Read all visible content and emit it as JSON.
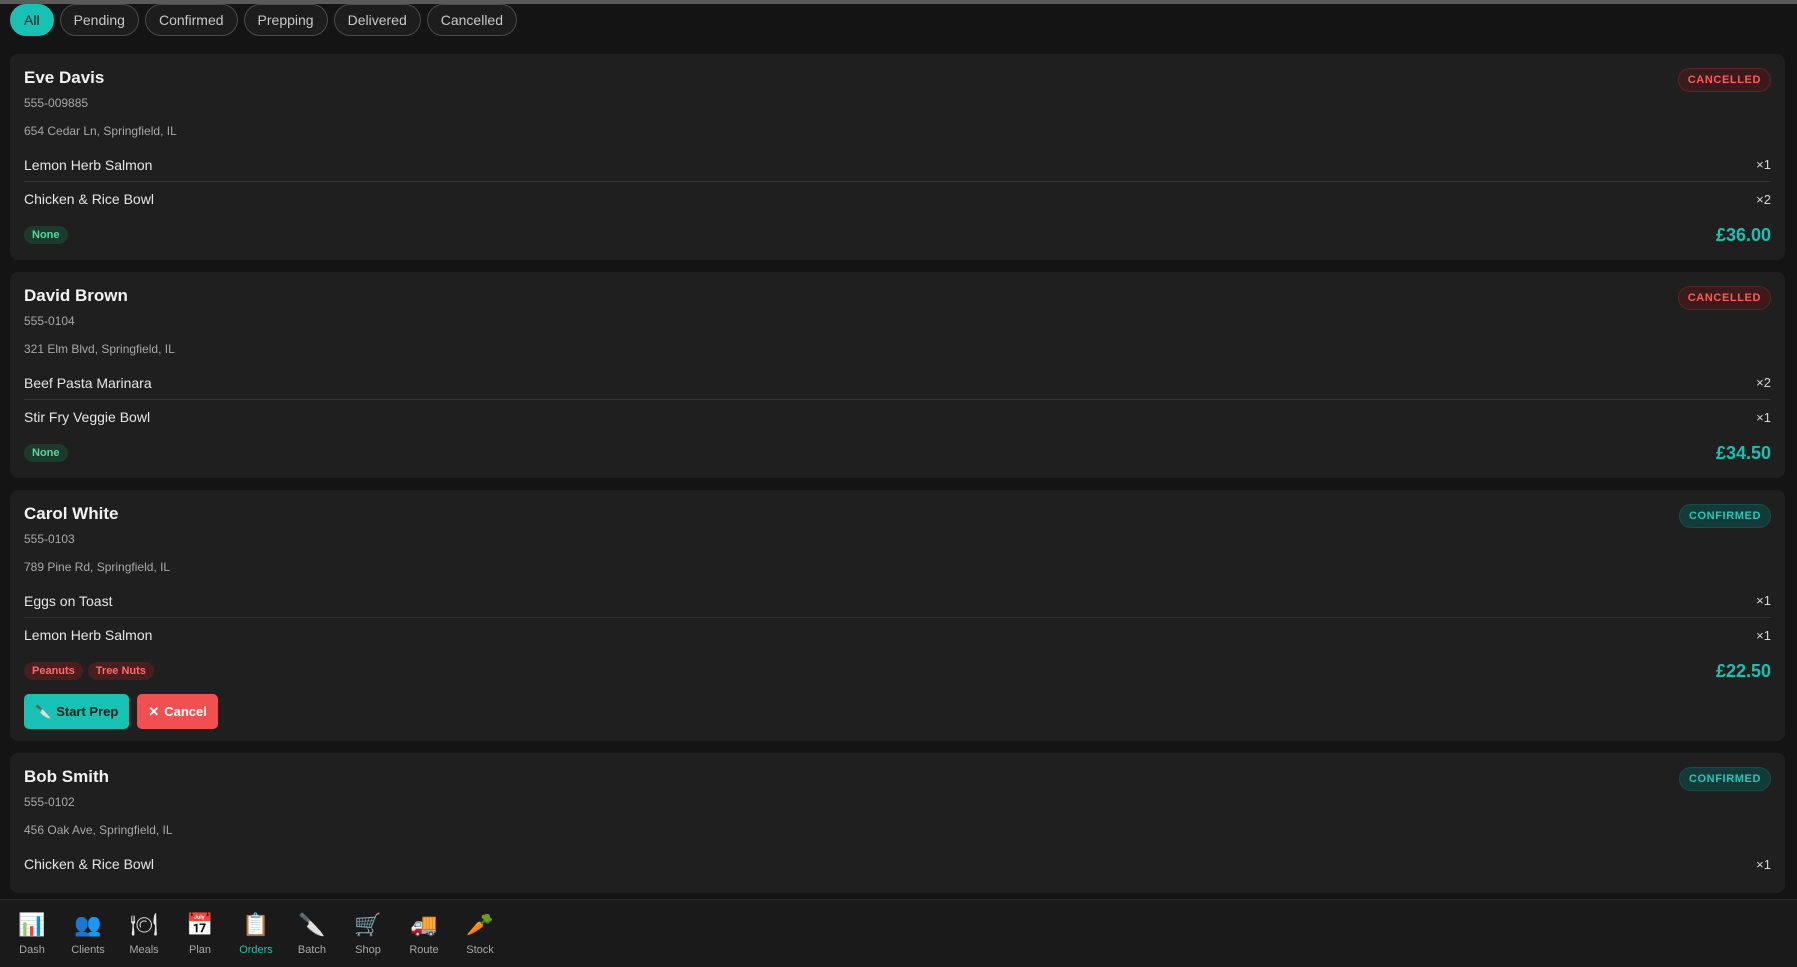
{
  "filters": [
    {
      "label": "All",
      "active": true
    },
    {
      "label": "Pending"
    },
    {
      "label": "Confirmed"
    },
    {
      "label": "Prepping"
    },
    {
      "label": "Delivered"
    },
    {
      "label": "Cancelled"
    }
  ],
  "orders": [
    {
      "name": "Eve Davis",
      "phone": "555-009885",
      "address": "654 Cedar Ln, Springfield, IL",
      "status": "CANCELLED",
      "items": [
        {
          "name": "Lemon Herb Salmon",
          "qty": "×1"
        },
        {
          "name": "Chicken & Rice Bowl",
          "qty": "×2"
        }
      ],
      "allergens": [
        "None"
      ],
      "total": "£36.00"
    },
    {
      "name": "David Brown",
      "phone": "555-0104",
      "address": "321 Elm Blvd, Springfield, IL",
      "status": "CANCELLED",
      "items": [
        {
          "name": "Beef Pasta Marinara",
          "qty": "×2"
        },
        {
          "name": "Stir Fry Veggie Bowl",
          "qty": "×1"
        }
      ],
      "allergens": [
        "None"
      ],
      "total": "£34.50"
    },
    {
      "name": "Carol White",
      "phone": "555-0103",
      "address": "789 Pine Rd, Springfield, IL",
      "status": "CONFIRMED",
      "items": [
        {
          "name": "Eggs on Toast",
          "qty": "×1"
        },
        {
          "name": "Lemon Herb Salmon",
          "qty": "×1"
        }
      ],
      "allergens": [
        "Peanuts",
        "Tree Nuts"
      ],
      "total": "£22.50",
      "actions": {
        "start_prep": "Start Prep",
        "cancel": "Cancel"
      }
    },
    {
      "name": "Bob Smith",
      "phone": "555-0102",
      "address": "456 Oak Ave, Springfield, IL",
      "status": "CONFIRMED",
      "items": [
        {
          "name": "Chicken & Rice Bowl",
          "qty": "×1"
        }
      ]
    }
  ],
  "nav": [
    {
      "label": "Dash",
      "icon": "📊"
    },
    {
      "label": "Clients",
      "icon": "👥"
    },
    {
      "label": "Meals",
      "icon": "🍽"
    },
    {
      "label": "Plan",
      "icon": "📅"
    },
    {
      "label": "Orders",
      "icon": "📋",
      "active": true
    },
    {
      "label": "Batch",
      "icon": "🔪"
    },
    {
      "label": "Shop",
      "icon": "🛒"
    },
    {
      "label": "Route",
      "icon": "🚚"
    },
    {
      "label": "Stock",
      "icon": "🥕"
    }
  ],
  "colors": {
    "accent": "#17c2b4",
    "cancelled": "#ff5a5a",
    "danger": "#f25050"
  }
}
